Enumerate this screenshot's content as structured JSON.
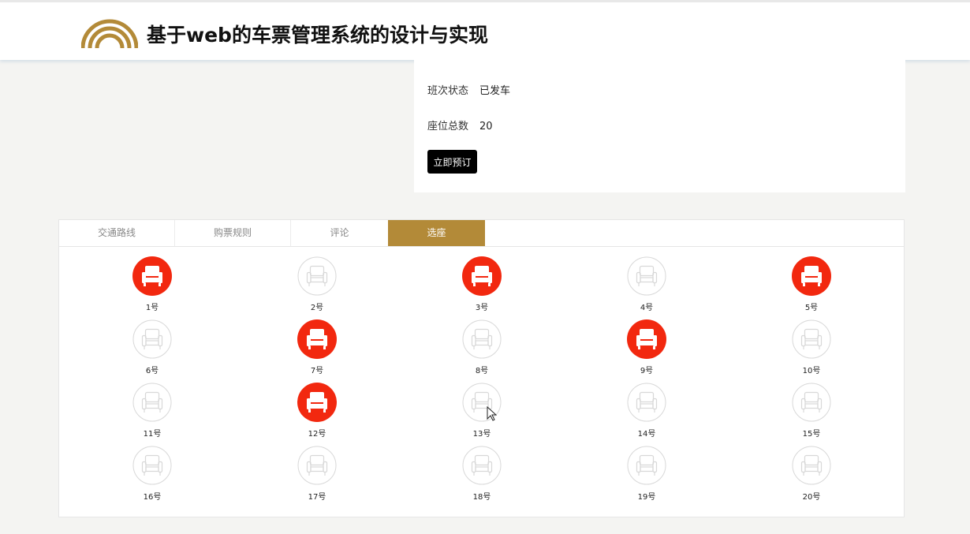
{
  "header": {
    "title": "基于web的车票管理系统的设计与实现",
    "logo_color": "#b38a38"
  },
  "trip": {
    "status_label": "班次状态",
    "status_value": "已发车",
    "seats_label": "座位总数",
    "seats_value": "20",
    "book_button": "立即预订"
  },
  "tabs": [
    {
      "label": "交通路线",
      "active": false
    },
    {
      "label": "购票规则",
      "active": false
    },
    {
      "label": "评论",
      "active": false
    },
    {
      "label": "选座",
      "active": true
    }
  ],
  "colors": {
    "accent": "#b38a38",
    "seat_taken": "#f2280f",
    "seat_free_stroke": "#d8d8d8"
  },
  "seats": [
    {
      "label": "1号",
      "taken": true
    },
    {
      "label": "2号",
      "taken": false
    },
    {
      "label": "3号",
      "taken": true
    },
    {
      "label": "4号",
      "taken": false
    },
    {
      "label": "5号",
      "taken": true
    },
    {
      "label": "6号",
      "taken": false
    },
    {
      "label": "7号",
      "taken": true
    },
    {
      "label": "8号",
      "taken": false
    },
    {
      "label": "9号",
      "taken": true
    },
    {
      "label": "10号",
      "taken": false
    },
    {
      "label": "11号",
      "taken": false
    },
    {
      "label": "12号",
      "taken": true
    },
    {
      "label": "13号",
      "taken": false
    },
    {
      "label": "14号",
      "taken": false
    },
    {
      "label": "15号",
      "taken": false
    },
    {
      "label": "16号",
      "taken": false
    },
    {
      "label": "17号",
      "taken": false
    },
    {
      "label": "18号",
      "taken": false
    },
    {
      "label": "19号",
      "taken": false
    },
    {
      "label": "20号",
      "taken": false
    }
  ]
}
